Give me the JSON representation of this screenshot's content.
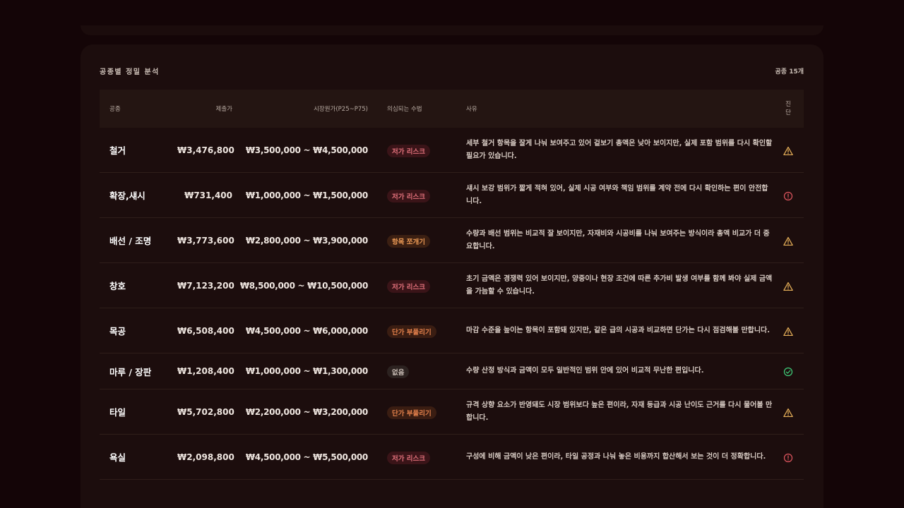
{
  "panel": {
    "title": "공종별 정밀 분석",
    "count": "공종 15개"
  },
  "table": {
    "headers": {
      "trade": "공종",
      "price": "제출가",
      "range": "시장원가(P25~P75)",
      "tactic": "의심되는 수법",
      "reason": "사유",
      "diag_line1": "진",
      "diag_line2": "단"
    },
    "rows": [
      {
        "trade": "철거",
        "price": "₩3,476,800",
        "range": "₩3,500,000 ~ ₩4,500,000",
        "tag": "저가 리스크",
        "reason": "세부 철거 항목을 잘게 나눠 보여주고 있어 겉보기 총액은 낮아 보이지만, 실제 포함 범위를 다시 확인할 필요가 있습니다."
      },
      {
        "trade": "확장,섀시",
        "price": "₩731,400",
        "range": "₩1,000,000 ~ ₩1,500,000",
        "tag": "저가 리스크",
        "reason": "섀시 보강 범위가 짧게 적혀 있어, 실제 시공 여부와 책임 범위를 계약 전에 다시 확인하는 편이 안전합니다."
      },
      {
        "trade": "배선 / 조명",
        "price": "₩3,773,600",
        "range": "₩2,800,000 ~ ₩3,900,000",
        "tag": "항목 쪼개기",
        "reason": "수량과 배선 범위는 비교적 잘 보이지만, 자재비와 시공비를 나눠 보여주는 방식이라 총액 비교가 더 중요합니다."
      },
      {
        "trade": "창호",
        "price": "₩7,123,200",
        "range": "₩8,500,000 ~ ₩10,500,000",
        "tag": "저가 리스크",
        "reason": "초기 금액은 경쟁력 있어 보이지만, 양중이나 현장 조건에 따른 추가비 발생 여부를 함께 봐야 실제 금액을 가늠할 수 있습니다."
      },
      {
        "trade": "목공",
        "price": "₩6,508,400",
        "range": "₩4,500,000 ~ ₩6,000,000",
        "tag": "단가 부풀리기",
        "reason": "마감 수준을 높이는 항목이 포함돼 있지만, 같은 급의 시공과 비교하면 단가는 다시 점검해볼 만합니다."
      },
      {
        "trade": "마루 / 장판",
        "price": "₩1,208,400",
        "range": "₩1,000,000 ~ ₩1,300,000",
        "tag": "없음",
        "reason": "수량 산정 방식과 금액이 모두 일반적인 범위 안에 있어 비교적 무난한 편입니다."
      },
      {
        "trade": "타일",
        "price": "₩5,702,800",
        "range": "₩2,200,000 ~ ₩3,200,000",
        "tag": "단가 부풀리기",
        "reason": "규격 상향 요소가 반영돼도 시장 범위보다 높은 편이라, 자재 등급과 시공 난이도 근거를 다시 물어볼 만합니다."
      },
      {
        "trade": "욕실",
        "price": "₩2,098,800",
        "range": "₩4,500,000 ~ ₩5,500,000",
        "tag": "저가 리스크",
        "reason": "구성에 비해 금액이 낮은 편이라, 타일 공정과 나눠 놓은 비용까지 합산해서 보는 것이 더 정확합니다."
      }
    ]
  },
  "meta": {
    "row_tag_kinds": [
      "risk",
      "risk",
      "split",
      "risk",
      "inflate",
      "none",
      "inflate",
      "risk"
    ],
    "row_diag_icons": [
      "warning-icon",
      "alert-circle-icon",
      "warning-icon",
      "warning-icon",
      "warning-icon",
      "check-circle-icon",
      "warning-icon",
      "alert-circle-icon"
    ],
    "colors": {
      "warning": "#e9b25a",
      "danger": "#e0565f",
      "ok": "#3fcf7a"
    }
  }
}
